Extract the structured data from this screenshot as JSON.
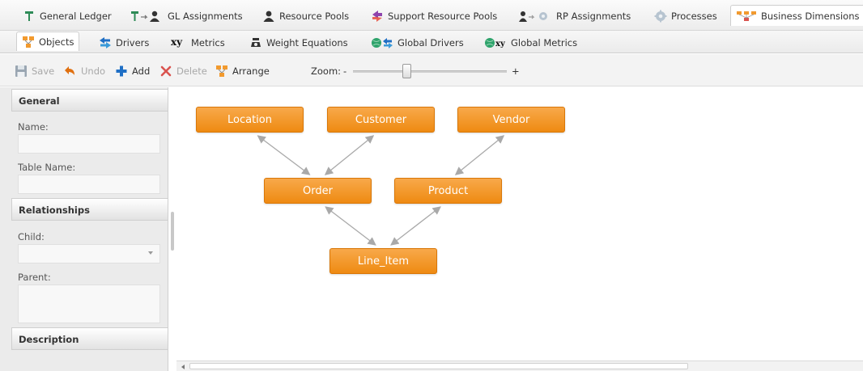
{
  "top_tabs": [
    {
      "label": "General Ledger",
      "icon": "ledger-icon"
    },
    {
      "label": "GL Assignments",
      "icon": "gl-assignment-icon"
    },
    {
      "label": "Resource Pools",
      "icon": "person-icon"
    },
    {
      "label": "Support Resource Pools",
      "icon": "support-arrows-icon"
    },
    {
      "label": "RP Assignments",
      "icon": "rp-assignment-icon"
    },
    {
      "label": "Processes",
      "icon": "gear-icon"
    },
    {
      "label": "Business Dimensions",
      "icon": "hierarchy-icon",
      "active": true
    }
  ],
  "sub_tabs": [
    {
      "label": "Objects",
      "icon": "objects-hierarchy-icon",
      "active": true
    },
    {
      "label": "Drivers",
      "icon": "drivers-arrows-icon"
    },
    {
      "label": "Metrics",
      "icon": "xy-icon",
      "icon_text": "xy"
    },
    {
      "label": "Weight Equations",
      "icon": "scale-icon"
    },
    {
      "label": "Global Drivers",
      "icon": "global-drivers-icon"
    },
    {
      "label": "Global Metrics",
      "icon": "global-metrics-icon",
      "icon_text": "xy"
    }
  ],
  "toolbar": {
    "save_label": "Save",
    "undo_label": "Undo",
    "add_label": "Add",
    "delete_label": "Delete",
    "arrange_label": "Arrange",
    "zoom_label": "Zoom:",
    "zoom_minus": "-",
    "zoom_plus": "+",
    "zoom_level": 0.35
  },
  "left_panel": {
    "general_header": "General",
    "name_label": "Name:",
    "name_value": "",
    "table_name_label": "Table Name:",
    "table_name_value": "",
    "relationships_header": "Relationships",
    "child_label": "Child:",
    "child_value": "",
    "parent_label": "Parent:",
    "parent_value": "",
    "description_header": "Description"
  },
  "diagram": {
    "nodes": {
      "location": "Location",
      "customer": "Customer",
      "vendor": "Vendor",
      "order": "Order",
      "product": "Product",
      "line_item": "Line_Item"
    },
    "edges": [
      [
        "location",
        "order"
      ],
      [
        "customer",
        "order"
      ],
      [
        "vendor",
        "product"
      ],
      [
        "order",
        "line_item"
      ],
      [
        "product",
        "line_item"
      ]
    ]
  },
  "colors": {
    "node_fill": "#f29a2e",
    "edge": "#a9a9a9",
    "accent_blue": "#1f6fc5",
    "undo_orange": "#e07010",
    "delete_red": "#d9534f"
  }
}
